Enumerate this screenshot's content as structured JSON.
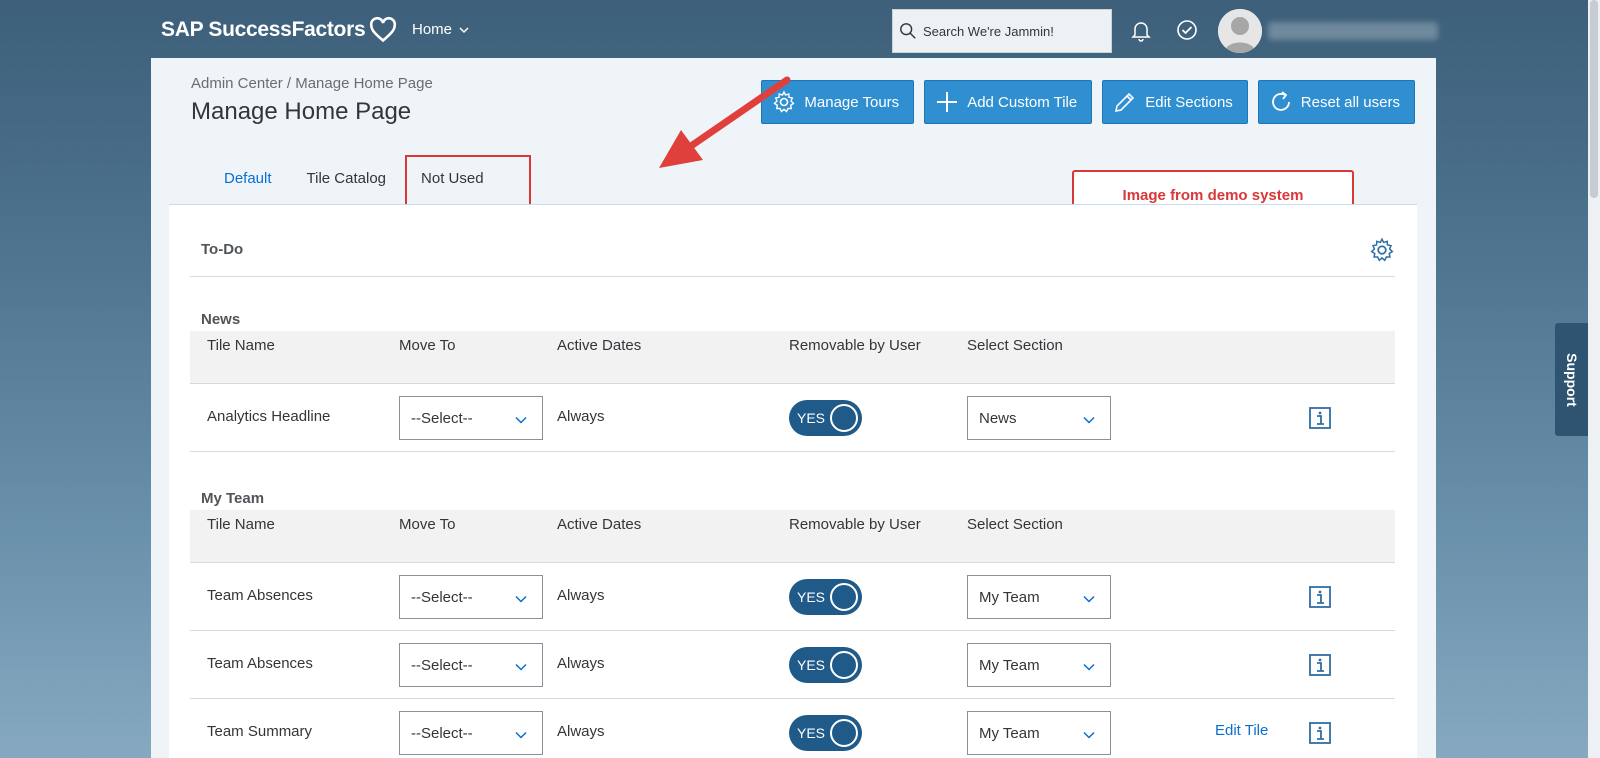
{
  "shell": {
    "logo_text": "SAP SuccessFactors",
    "home_menu_label": "Home",
    "search_placeholder": "Search We're Jammin!",
    "icons": [
      "heart-icon",
      "chevron-down-icon",
      "search-icon",
      "bell-icon",
      "check-circle-icon",
      "avatar"
    ]
  },
  "header": {
    "breadcrumb": "Admin Center / Manage Home Page",
    "title": "Manage Home Page",
    "actions": [
      {
        "label": "Manage Tours",
        "icon": "gear-icon"
      },
      {
        "label": "Add Custom Tile",
        "icon": "plus-icon"
      },
      {
        "label": "Edit Sections",
        "icon": "pencil-icon"
      },
      {
        "label": "Reset all users",
        "icon": "refresh-icon"
      }
    ]
  },
  "tabs": [
    {
      "label": "Default",
      "active": true
    },
    {
      "label": "Tile Catalog",
      "active": false
    },
    {
      "label": "Not Used",
      "active": false
    }
  ],
  "annotation": {
    "note": "Image from demo system",
    "color": "#d9373a"
  },
  "todo": {
    "title": "To-Do"
  },
  "columns": [
    "Tile Name",
    "Move To",
    "Active Dates",
    "Removable by User",
    "Select Section"
  ],
  "sections": [
    {
      "title": "News",
      "rows": [
        {
          "tile": "Analytics Headline",
          "move_to": "--Select--",
          "dates": "Always",
          "removable": "YES",
          "section": "News",
          "edit": ""
        }
      ]
    },
    {
      "title": "My Team",
      "rows": [
        {
          "tile": "Team Absences",
          "move_to": "--Select--",
          "dates": "Always",
          "removable": "YES",
          "section": "My Team",
          "edit": ""
        },
        {
          "tile": "Team Absences",
          "move_to": "--Select--",
          "dates": "Always",
          "removable": "YES",
          "section": "My Team",
          "edit": ""
        },
        {
          "tile": "Team Summary",
          "move_to": "--Select--",
          "dates": "Always",
          "removable": "YES",
          "section": "My Team",
          "edit": "Edit Tile"
        }
      ]
    }
  ],
  "support_label": "Support",
  "colors": {
    "accent": "#0a6ed1",
    "button": "#2f8fd0",
    "toggle": "#1f5a88",
    "shell_bg": "#3d5f7a"
  }
}
